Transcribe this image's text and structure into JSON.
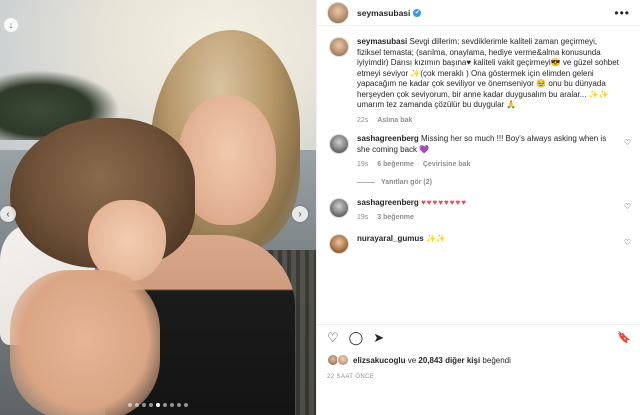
{
  "post": {
    "username": "seymasubasi",
    "verified_mark": "✔",
    "more_icon": "•••",
    "carousel": {
      "dot_count": 9,
      "active_index": 4
    }
  },
  "caption": {
    "username": "seymasubasi",
    "text": "Sevgi dillerim; sevdiklerimle kaliteli zaman geçirmeyi, fiziksel temasta; (sarılma, onaylama, hediye verme&alma konusunda iyiyimdir) Darısı kızımın başına♥ kaliteli vakit geçirmeyi😎 ve güzel sohbet etmeyi seviyor ✨(çok meraklı ) Ona göstermek için elimden geleni yapacağım ne kadar çok seviliyor ve önemseniyor 🥹 onu bu dünyada herşeyden çok seviyorum, bir anne kadar duygusalım bu aralar... ✨✨ umarım tez zamanda çözülür bu duygular 🙏",
    "time": "22s",
    "see_translation": "Aslına bak"
  },
  "comments": [
    {
      "username": "sashagreenberg",
      "text": "Missing her so much !!! Boy's always asking when is she coming back 💜",
      "time": "19s",
      "likes": "6 beğenme",
      "action": "Çevirisine bak"
    },
    {
      "username": "sashagreenberg",
      "text": "♥♥♥♥♥♥♥♥",
      "time": "19s",
      "likes": "3 beğenme",
      "action": ""
    },
    {
      "username": "nurayaral_gumus",
      "text": "✨✨",
      "time": "",
      "likes": "",
      "action": ""
    }
  ],
  "replies_label": "Yanıtları gör (2)",
  "actions": {
    "like_icon": "♡",
    "comment_icon": "◯",
    "share_icon": "➤",
    "save_icon": "🔖"
  },
  "likes": {
    "user": "elizsakucoglu",
    "connector": " ve ",
    "count": "20,843 diğer kişi",
    "suffix": " beğendi"
  },
  "timestamp": "22 SAAT ÖNCE"
}
